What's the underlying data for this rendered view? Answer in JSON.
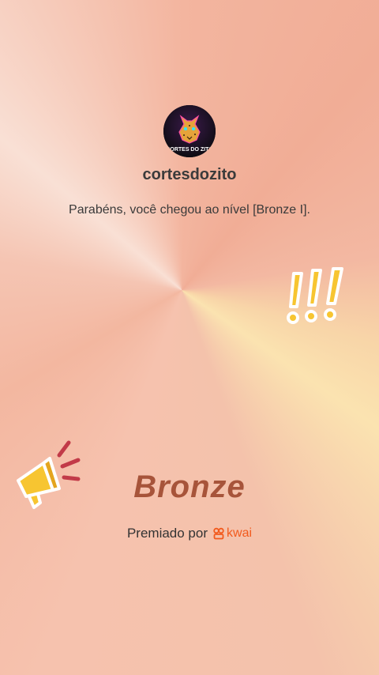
{
  "profile": {
    "avatar_text": "CORTES DO ZITO",
    "username": "cortesdozito"
  },
  "message": "Parabéns, você chegou ao nível [Bronze I].",
  "decorations": {
    "exclamation": "exclamation-marks-icon",
    "megaphone": "megaphone-icon"
  },
  "level": {
    "title": "Bronze"
  },
  "awarded": {
    "label": "Premiado por",
    "brand": "kwai",
    "brand_color": "#f25a1d"
  },
  "colors": {
    "level_text": "#a7543a",
    "username_text": "#3b3b3b"
  }
}
